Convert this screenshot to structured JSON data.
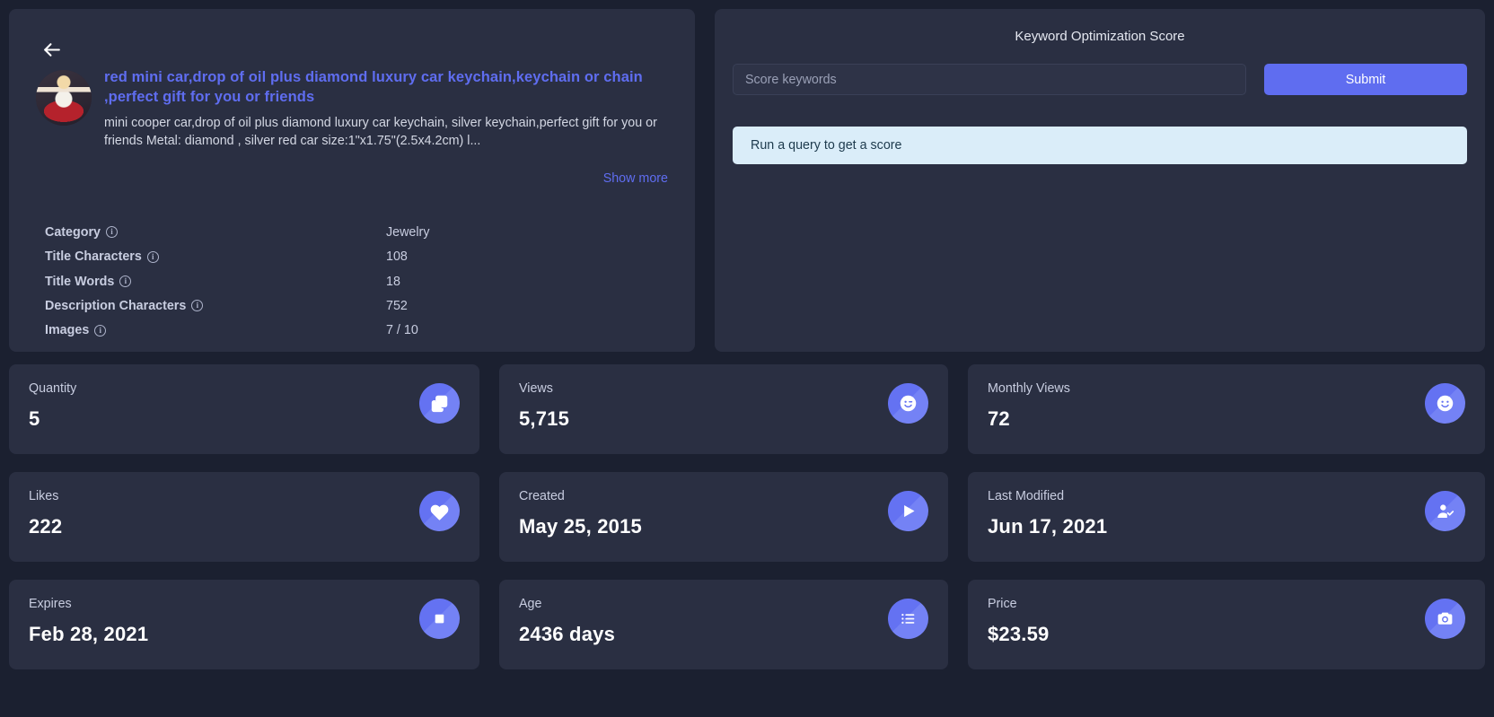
{
  "listing": {
    "back_icon": "arrow-left-icon",
    "title": "red mini car,drop of oil plus diamond luxury car keychain,keychain or chain ,perfect gift for you or friends",
    "description": "mini cooper car,drop of oil plus diamond luxury car keychain, silver keychain,perfect gift for you or friends Metal: diamond , silver red car size:1\"x1.75\"(2.5x4.2cm) l...",
    "show_more": "Show more",
    "meta": [
      {
        "label": "Category",
        "value": "Jewelry",
        "info": "i"
      },
      {
        "label": "Title Characters",
        "value": "108",
        "info": "i"
      },
      {
        "label": "Title Words",
        "value": "18",
        "info": "i"
      },
      {
        "label": "Description Characters",
        "value": "752",
        "info": "i"
      },
      {
        "label": "Images",
        "value": "7 / 10",
        "info": "i"
      }
    ]
  },
  "keyword": {
    "title": "Keyword Optimization Score",
    "placeholder": "Score keywords",
    "value": "",
    "submit_label": "Submit",
    "alert": "Run a query to get a score",
    "accent_color": "#5f6df0",
    "alert_bg": "#daedf9"
  },
  "cards": [
    {
      "label": "Quantity",
      "value": "5",
      "icon": "duplicate-check-icon"
    },
    {
      "label": "Views",
      "value": "5,715",
      "icon": "smiley-wink-icon"
    },
    {
      "label": "Monthly Views",
      "value": "72",
      "icon": "smiley-icon"
    },
    {
      "label": "Likes",
      "value": "222",
      "icon": "heart-icon"
    },
    {
      "label": "Created",
      "value": "May 25, 2015",
      "icon": "play-icon"
    },
    {
      "label": "Last Modified",
      "value": "Jun 17, 2021",
      "icon": "user-check-icon"
    },
    {
      "label": "Expires",
      "value": "Feb 28, 2021",
      "icon": "stop-square-icon"
    },
    {
      "label": "Age",
      "value": "2436 days",
      "icon": "list-icon"
    },
    {
      "label": "Price",
      "value": "$23.59",
      "icon": "camera-icon"
    }
  ]
}
